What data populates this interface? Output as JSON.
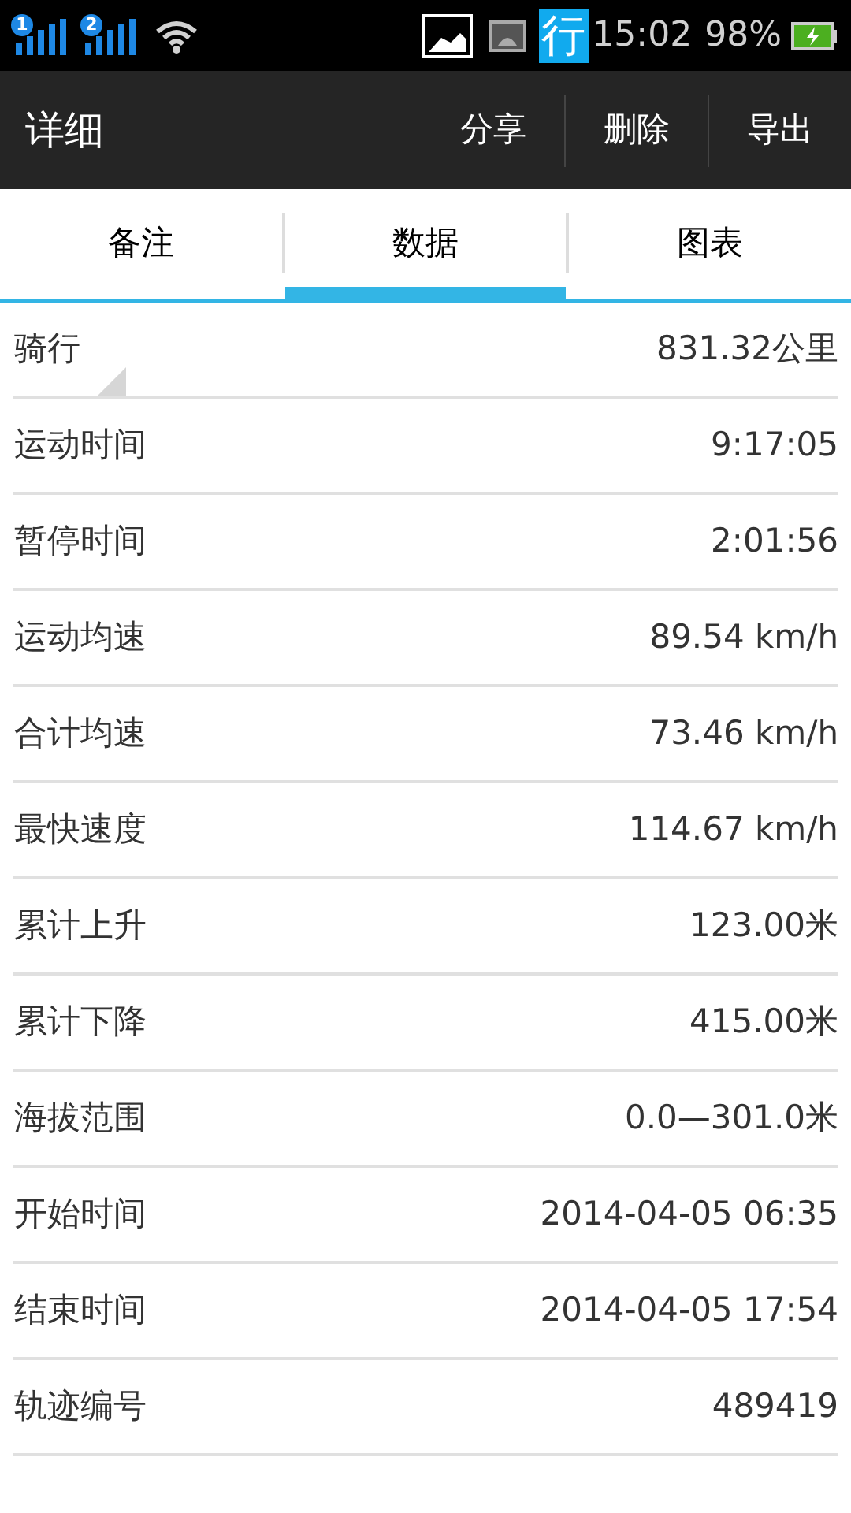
{
  "status_bar": {
    "sim_badges": [
      "1",
      "2"
    ],
    "notification_text": "行",
    "time": "15:02",
    "battery": "98%"
  },
  "action_bar": {
    "title": "详细",
    "actions": [
      "分享",
      "删除",
      "导出"
    ]
  },
  "tabs": [
    {
      "label": "备注",
      "selected": false
    },
    {
      "label": "数据",
      "selected": true
    },
    {
      "label": "图表",
      "selected": false
    }
  ],
  "rows": [
    {
      "kind": "dropdown",
      "label": "骑行",
      "value": "831.32公里"
    },
    {
      "kind": "plain",
      "label": "运动时间",
      "value": "9:17:05"
    },
    {
      "kind": "plain",
      "label": "暂停时间",
      "value": "2:01:56"
    },
    {
      "kind": "plain",
      "label": "运动均速",
      "value": "89.54 km/h"
    },
    {
      "kind": "plain",
      "label": "合计均速",
      "value": "73.46 km/h"
    },
    {
      "kind": "plain",
      "label": "最快速度",
      "value": "114.67 km/h"
    },
    {
      "kind": "plain",
      "label": "累计上升",
      "value": "123.00米"
    },
    {
      "kind": "plain",
      "label": "累计下降",
      "value": "415.00米"
    },
    {
      "kind": "plain",
      "label": "海拔范围",
      "value": "0.0—301.0米"
    },
    {
      "kind": "plain",
      "label": "开始时间",
      "value": "2014-04-05 06:35"
    },
    {
      "kind": "plain",
      "label": "结束时间",
      "value": "2014-04-05 17:54"
    },
    {
      "kind": "plain",
      "label": "轨迹编号",
      "value": "489419"
    }
  ]
}
